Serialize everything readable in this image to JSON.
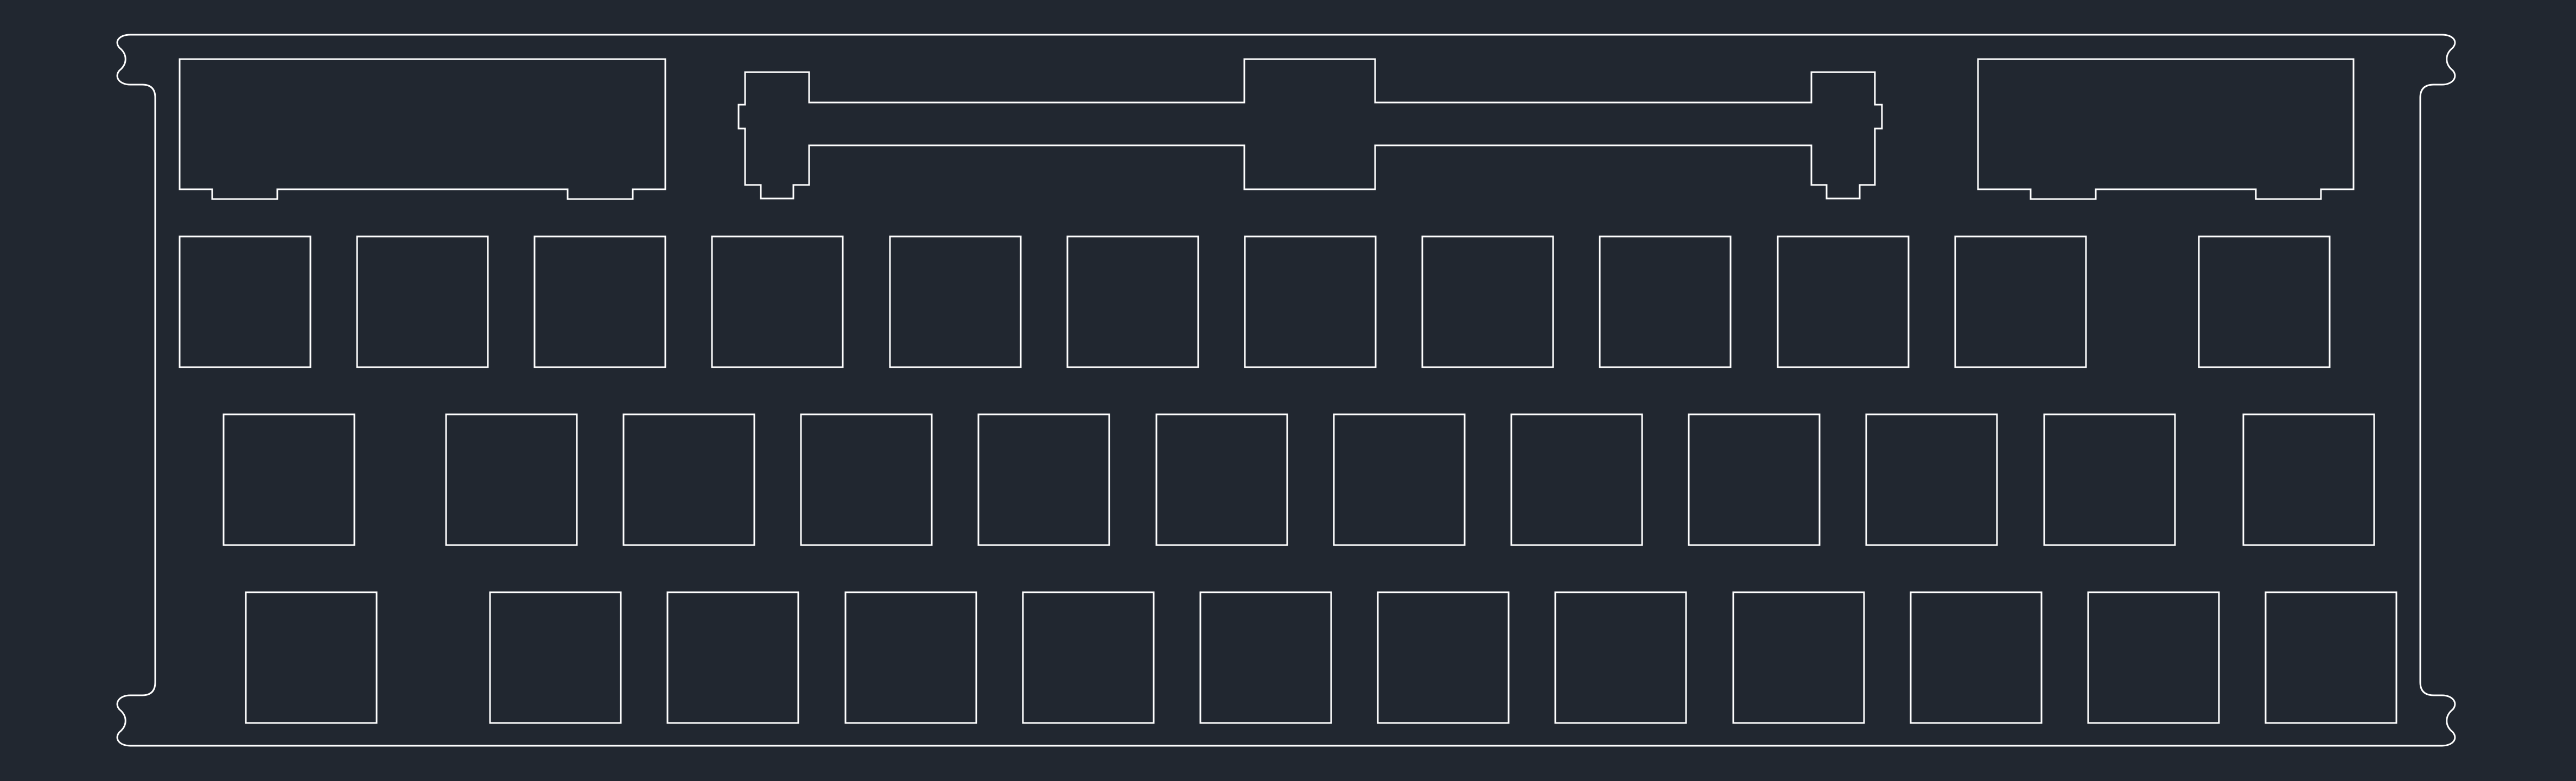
{
  "colors": {
    "background": "#212730",
    "line": "#ffffff"
  },
  "plate": {
    "outline": "plate-outline",
    "stabilizer_cutouts": [
      "stabilizer-cutout-left",
      "stabilizer-cutout-center",
      "stabilizer-cutout-right"
    ],
    "rows": [
      {
        "name": "row-1",
        "switch_count": 12
      },
      {
        "name": "row-2",
        "switch_count": 12
      },
      {
        "name": "row-3",
        "switch_count": 12
      }
    ]
  }
}
